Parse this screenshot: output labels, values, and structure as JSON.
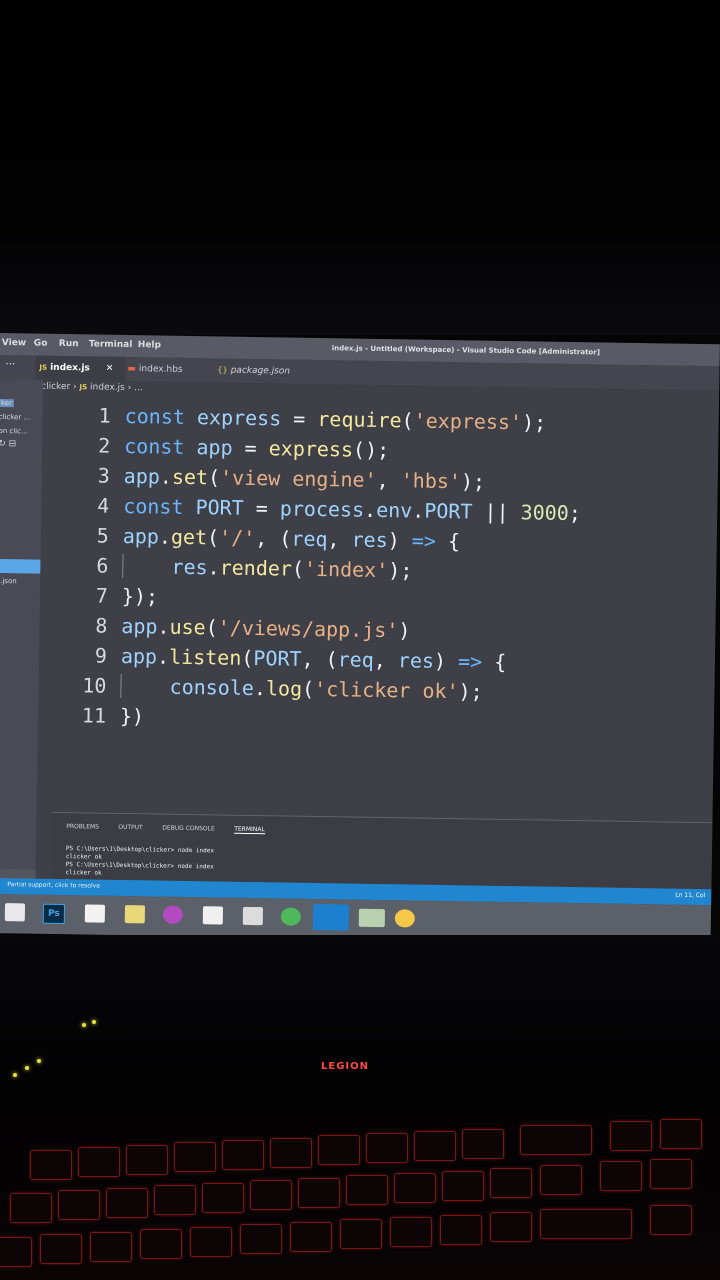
{
  "menubar": {
    "items": [
      "View",
      "Go",
      "Run",
      "Terminal",
      "Help"
    ],
    "window_title": "index.js - Untitled (Workspace) - Visual Studio Code [Administrator]"
  },
  "tabs": [
    {
      "label": "index.js",
      "icon": "JS",
      "active": true
    },
    {
      "label": "index.hbs",
      "icon": "hbs-icon",
      "active": false
    },
    {
      "label": "package.json",
      "icon": "{}",
      "active": false
    }
  ],
  "breadcrumb": {
    "folder": "clicker",
    "file": "index.js",
    "symbol": "..."
  },
  "sidebar": {
    "items": [
      "ker",
      "clicker ...",
      "on clic...",
      "k.json",
      "n"
    ]
  },
  "code": {
    "line_numbers": [
      "1",
      "2",
      "3",
      "4",
      "5",
      "6",
      "7",
      "8",
      "9",
      "10",
      "11"
    ],
    "lines": [
      "const express = require('express');",
      "const app = express();",
      "app.set('view engine', 'hbs');",
      "const PORT = process.env.PORT || 3000;",
      "app.get('/', (req, res) => {",
      "    res.render('index');",
      "});",
      "app.use('/views/app.js')",
      "app.listen(PORT, (req, res) => {",
      "    console.log('clicker ok');",
      "})"
    ]
  },
  "panel": {
    "tabs": [
      "PROBLEMS",
      "OUTPUT",
      "DEBUG CONSOLE",
      "TERMINAL"
    ],
    "terminal_lines": [
      "PS C:\\Users\\1\\Desktop\\clicker> node index",
      "clicker ok",
      "PS C:\\Users\\1\\Desktop\\clicker> node index",
      "clicker ok"
    ]
  },
  "statusbar": {
    "left": "Partial support, click to resolve",
    "right": "Ln 11, Col"
  },
  "taskbar": {
    "ps_label": "Ps"
  },
  "keyboard": {
    "logo_text": "LEGION"
  },
  "colors": {
    "editor_bg": "#3f3f48",
    "statusbar": "#1f86cf",
    "keyword": "#6ab6ff",
    "string": "#e7b186",
    "keyboard_glow": "#ff3a2e"
  }
}
